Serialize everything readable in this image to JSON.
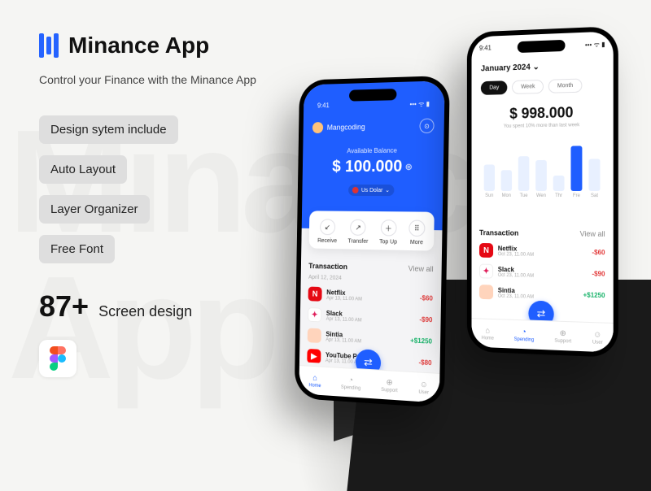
{
  "brand": "Minance App",
  "subtitle": "Control your Finance with the Minance App",
  "chips": [
    "Design sytem include",
    "Auto Layout",
    "Layer Organizer",
    "Free Font"
  ],
  "count": {
    "number": "87+",
    "label": "Screen design"
  },
  "phone1": {
    "status_time": "9:41",
    "username": "Mangcoding",
    "balance_label": "Available Balance",
    "balance_amount": "$ 100.000",
    "currency": "Us Dolar",
    "actions": [
      "Receive",
      "Transfer",
      "Top Up",
      "More"
    ],
    "section_title": "Transaction",
    "view_all": "View all",
    "date": "April 12, 2024",
    "items": [
      {
        "name": "Netflix",
        "sub": "Apr 13, 11.00 AM",
        "amount": "-$60",
        "cls": "neg",
        "logo_bg": "#e50914",
        "logo_txt": "N"
      },
      {
        "name": "Slack",
        "sub": "Apr 13, 11.00 AM",
        "amount": "-$90",
        "cls": "neg",
        "logo_bg": "#ffffff",
        "logo_txt": "✦"
      },
      {
        "name": "Sintia",
        "sub": "Apr 13, 11.00 AM",
        "amount": "+$1250",
        "cls": "pos",
        "logo_bg": "#ffd4bc",
        "logo_txt": ""
      },
      {
        "name": "YouTube Pr…",
        "sub": "Apr 13, 11.00 AM",
        "amount": "-$80",
        "cls": "neg",
        "logo_bg": "#ff0000",
        "logo_txt": "▶"
      }
    ],
    "nav": [
      "Home",
      "Spending",
      "Support",
      "User"
    ],
    "nav_active": 0
  },
  "phone2": {
    "month": "January 2024",
    "tabs": [
      "Day",
      "Week",
      "Month"
    ],
    "tabs_active": 0,
    "amount": "$ 998.000",
    "amount_sub": "You spent 10% more than last week",
    "section_title": "Transaction",
    "view_all": "View all",
    "items": [
      {
        "name": "Netflix",
        "sub": "Oct 23, 11.00 AM",
        "amount": "-$60",
        "cls": "neg",
        "logo_bg": "#e50914",
        "logo_txt": "N"
      },
      {
        "name": "Slack",
        "sub": "Oct 23, 11.00 AM",
        "amount": "-$90",
        "cls": "neg",
        "logo_bg": "#ffffff",
        "logo_txt": "✦"
      },
      {
        "name": "Sintia",
        "sub": "Oct 23, 11.00 AM",
        "amount": "+$1250",
        "cls": "pos",
        "logo_bg": "#ffd4bc",
        "logo_txt": ""
      }
    ],
    "nav": [
      "Home",
      "Spending",
      "Support",
      "User"
    ],
    "nav_active": 1
  },
  "chart_data": {
    "type": "bar",
    "categories": [
      "Sun",
      "Mon",
      "Tue",
      "Wen",
      "Thr",
      "Fre",
      "Sat"
    ],
    "values": [
      38,
      30,
      50,
      44,
      22,
      64,
      46
    ],
    "title": "",
    "xlabel": "",
    "ylabel": "",
    "ylim": [
      0,
      70
    ],
    "active_index": 5
  }
}
